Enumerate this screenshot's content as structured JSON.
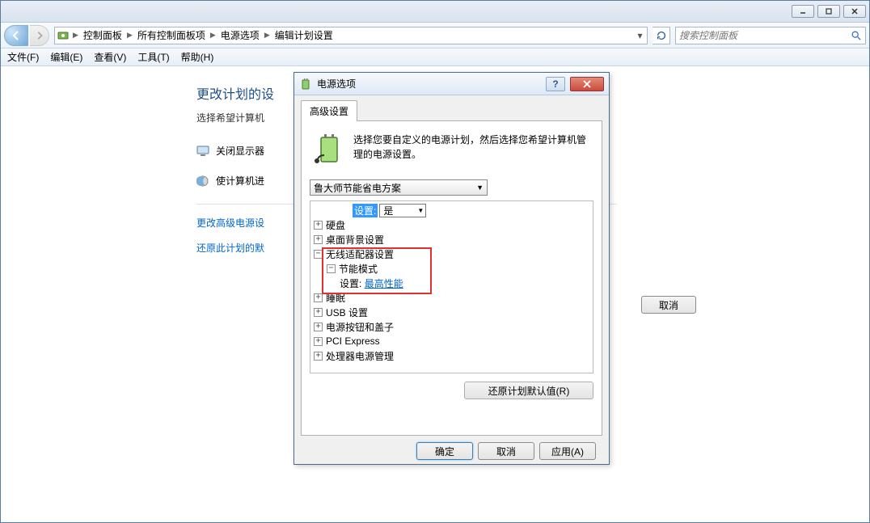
{
  "breadcrumb": {
    "b0": "控制面板",
    "b1": "所有控制面板项",
    "b2": "电源选项",
    "b3": "编辑计划设置"
  },
  "search": {
    "placeholder": "搜索控制面板"
  },
  "menu": {
    "file": "文件(F)",
    "edit": "编辑(E)",
    "view": "查看(V)",
    "tools": "工具(T)",
    "help": "帮助(H)"
  },
  "main": {
    "heading": "更改计划的设",
    "subtext": "选择希望计算机",
    "opt_display": "关闭显示器",
    "opt_sleep": "使计算机进",
    "link_adv": "更改高级电源设",
    "link_restore": "还原此计划的默",
    "cancel": "取消"
  },
  "dialog": {
    "title": "电源选项",
    "tab": "高级设置",
    "desc": "选择您要自定义的电源计划，然后选择您希望计算机管理的电源设置。",
    "plan": "鲁大师节能省电方案",
    "restore_btn": "还原计划默认值(R)",
    "ok": "确定",
    "cancel": "取消",
    "apply": "应用(A)",
    "tree": {
      "setting_label": "设置:",
      "setting_value": "是",
      "hdd": "硬盘",
      "desktop_bg": "桌面背景设置",
      "wireless": "无线适配器设置",
      "power_saving_mode": "节能模式",
      "ps_label": "设置:",
      "ps_value": "最高性能",
      "sleep": "睡眠",
      "usb": "USB 设置",
      "power_button": "电源按钮和盖子",
      "pci": "PCI Express",
      "cpu": "处理器电源管理"
    }
  }
}
